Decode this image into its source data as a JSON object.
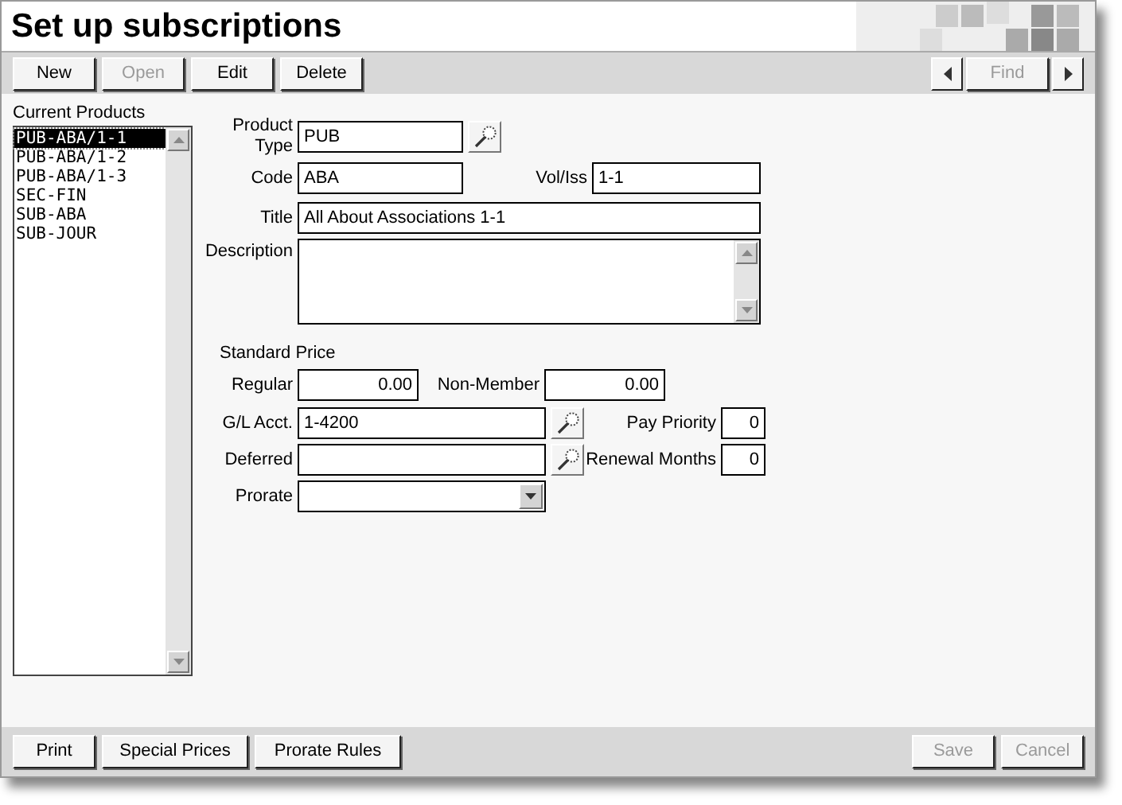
{
  "window": {
    "title": "Set up subscriptions"
  },
  "toolbar": {
    "buttons": [
      {
        "label": "New",
        "disabled": false
      },
      {
        "label": "Open",
        "disabled": true
      },
      {
        "label": "Edit",
        "disabled": false
      },
      {
        "label": "Delete",
        "disabled": false
      }
    ],
    "find": {
      "label": "Find",
      "disabled": true
    }
  },
  "products": {
    "label": "Current Products",
    "items": [
      {
        "label": "PUB-ABA/1-1",
        "selected": true
      },
      {
        "label": "PUB-ABA/1-2",
        "selected": false
      },
      {
        "label": "PUB-ABA/1-3",
        "selected": false
      },
      {
        "label": "SEC-FIN",
        "selected": false
      },
      {
        "label": "SUB-ABA",
        "selected": false
      },
      {
        "label": "SUB-JOUR",
        "selected": false
      }
    ]
  },
  "form": {
    "product_type": {
      "label": "Product Type",
      "value": "PUB"
    },
    "code": {
      "label": "Code",
      "value": "ABA"
    },
    "vol_iss": {
      "label": "Vol/Iss",
      "value": "1-1"
    },
    "title": {
      "label": "Title",
      "value": "All About Associations 1-1"
    },
    "description": {
      "label": "Description"
    },
    "standard_price": "Standard Price",
    "regular": {
      "label": "Regular",
      "value": "0.00"
    },
    "non_member": {
      "label": "Non-Member",
      "value": "0.00"
    },
    "gl_acct": {
      "label": "G/L Acct.",
      "value": "1-4200"
    },
    "pay_priority": {
      "label": "Pay Priority",
      "value": "0"
    },
    "deferred": {
      "label": "Deferred"
    },
    "renewal_months": {
      "label": "Renewal Months",
      "value": "0"
    },
    "prorate": {
      "label": "Prorate"
    }
  },
  "footer": {
    "left": [
      {
        "label": "Print",
        "disabled": false
      },
      {
        "label": "Special Prices",
        "disabled": false
      },
      {
        "label": "Prorate Rules",
        "disabled": false
      }
    ],
    "right": [
      {
        "label": "Save",
        "disabled": true
      },
      {
        "label": "Cancel",
        "disabled": true
      }
    ]
  }
}
